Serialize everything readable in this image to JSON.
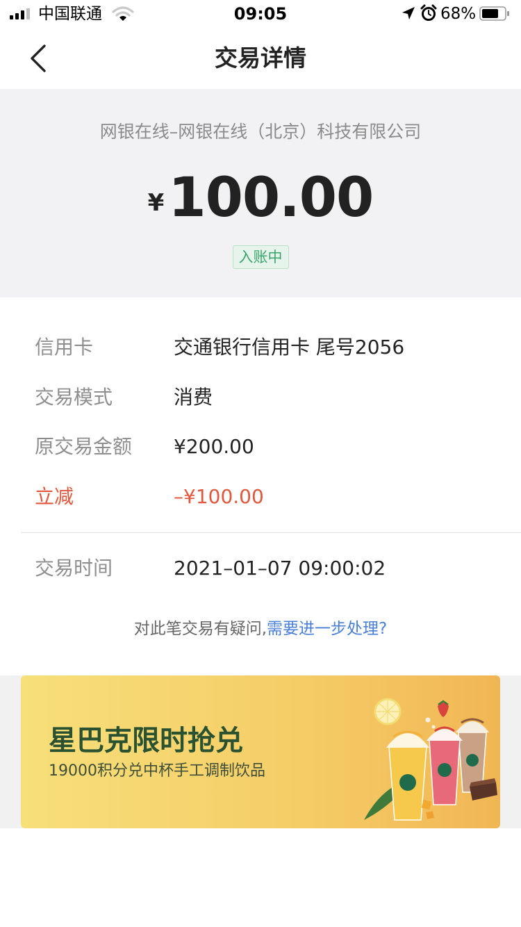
{
  "status_bar": {
    "carrier": "中国联通",
    "time": "09:05",
    "battery": "68%"
  },
  "nav": {
    "title": "交易详情"
  },
  "summary": {
    "merchant": "网银在线–网银在线（北京）科技有限公司",
    "currency_symbol": "¥",
    "amount": "100.00",
    "status": "入账中"
  },
  "details": {
    "rows": [
      {
        "label": "信用卡",
        "value": "交通银行信用卡 尾号2056"
      },
      {
        "label": "交易模式",
        "value": "消费"
      },
      {
        "label": "原交易金额",
        "value": "¥200.00"
      },
      {
        "label": "立减",
        "value": "–¥100.00"
      }
    ],
    "time_row": {
      "label": "交易时间",
      "value": "2021–01–07 09:00:02"
    },
    "question_text": "对此笔交易有疑问,",
    "question_link": "需要进一步处理?"
  },
  "banner": {
    "title": "星巴克限时抢兑",
    "subtitle": "19000积分兑中杯手工调制饮品"
  },
  "colors": {
    "discount": "#e2573b",
    "link": "#4a7fd8",
    "status_green": "#3aa66a",
    "banner_title": "#2a5231"
  }
}
